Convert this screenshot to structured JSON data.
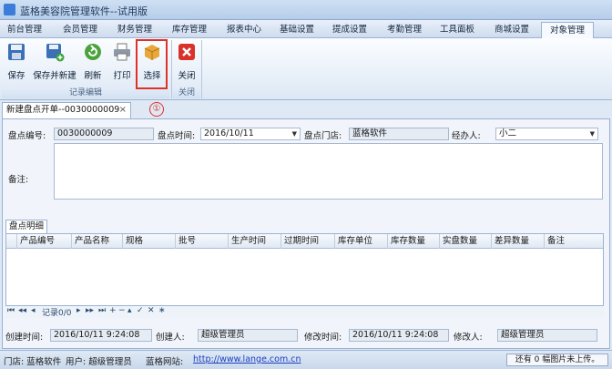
{
  "window": {
    "title": "蓝格美容院管理软件--试用版"
  },
  "menu": [
    {
      "label": "前台管理"
    },
    {
      "label": "会员管理"
    },
    {
      "label": "财务管理"
    },
    {
      "label": "库存管理"
    },
    {
      "label": "报表中心"
    },
    {
      "label": "基础设置"
    },
    {
      "label": "提成设置"
    },
    {
      "label": "考勤管理"
    },
    {
      "label": "工具面板"
    },
    {
      "label": "商城设置"
    },
    {
      "label": "对象管理"
    }
  ],
  "ribbon": {
    "buttons": [
      {
        "label": "保存",
        "icon": "floppy-icon"
      },
      {
        "label": "保存并新建",
        "icon": "floppy-plus-icon"
      },
      {
        "label": "刷新",
        "icon": "refresh-icon"
      },
      {
        "label": "打印",
        "icon": "printer-icon"
      },
      {
        "label": "选择",
        "icon": "box-icon"
      },
      {
        "label": "关闭",
        "icon": "close-red-icon"
      }
    ],
    "groups": [
      {
        "label": "记录编辑"
      },
      {
        "label": "关闭"
      }
    ]
  },
  "annotation": {
    "marker": "①",
    "color": "#e0302a"
  },
  "doc_tab": {
    "label": "新建盘点开单--0030000009",
    "close": "×"
  },
  "form": {
    "code_label": "盘点编号:",
    "code_value": "0030000009",
    "time_label": "盘点时间:",
    "time_value": "2016/10/11",
    "store_label": "盘点门店:",
    "store_value": "蓝格软件",
    "handler_label": "经办人:",
    "handler_value": "小二",
    "memo_label": "备注:"
  },
  "detail_tab": {
    "label": "盘点明细"
  },
  "grid": {
    "columns": [
      "产品编号",
      "产品名称",
      "规格",
      "批号",
      "生产时间",
      "过期时间",
      "库存单位",
      "库存数量",
      "实盘数量",
      "差异数量",
      "备注"
    ]
  },
  "navigator": {
    "record_text": "记录0/0"
  },
  "footer": {
    "created_time_label": "创建时间:",
    "created_time_value": "2016/10/11 9:24:08",
    "creator_label": "创建人:",
    "creator_value": "超级管理员",
    "modified_time_label": "修改时间:",
    "modified_time_value": "2016/10/11 9:24:08",
    "modifier_label": "修改人:",
    "modifier_value": "超级管理员"
  },
  "status": {
    "store": "门店: 蓝格软件",
    "user": "用户: 超级管理员",
    "site_label": "蓝格网站:",
    "site_url": "http://www.lange.com.cn",
    "images": "还有 0 幅图片未上传。"
  }
}
